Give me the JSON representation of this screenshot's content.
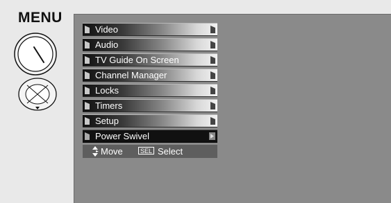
{
  "remote": {
    "menu_label": "MENU",
    "dial_icon": "menu-dial-icon",
    "nav_icon": "navigation-pad-icon"
  },
  "menu": {
    "items": [
      {
        "label": "Video",
        "selected": false
      },
      {
        "label": "Audio",
        "selected": false
      },
      {
        "label": "TV Guide On Screen",
        "selected": false
      },
      {
        "label": "Channel Manager",
        "selected": false
      },
      {
        "label": "Locks",
        "selected": false
      },
      {
        "label": "Timers",
        "selected": false
      },
      {
        "label": "Setup",
        "selected": false
      },
      {
        "label": "Power Swivel",
        "selected": true
      }
    ]
  },
  "hints": {
    "move_label": "Move",
    "sel_key": "SEL",
    "select_label": "Select"
  },
  "colors": {
    "screen_bg": "#8a8a8a",
    "selected_bg": "#111111",
    "hint_bg": "#5e5e5e",
    "page_bg": "#e9e9e9"
  }
}
